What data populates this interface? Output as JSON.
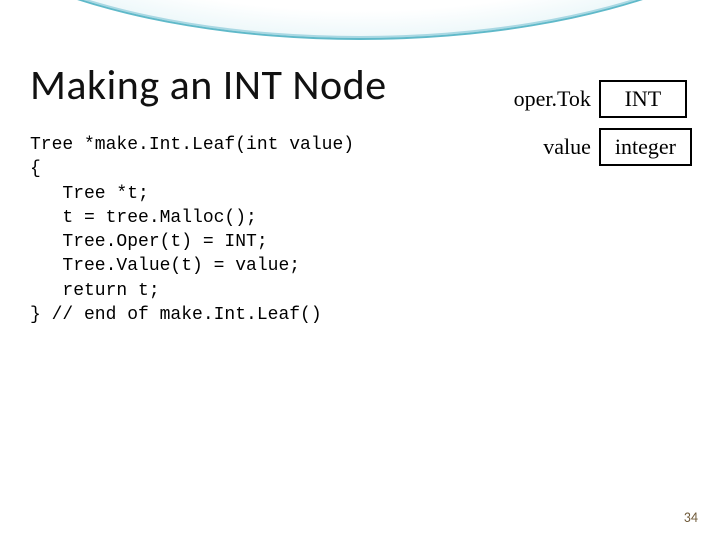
{
  "title": "Making an INT Node",
  "code": "Tree *make.Int.Leaf(int value)\n{\n   Tree *t;\n   t = tree.Malloc();\n   Tree.Oper(t) = INT;\n   Tree.Value(t) = value;\n   return t;\n} // end of make.Int.Leaf()",
  "diagram": {
    "row1": {
      "label": "oper.Tok",
      "box": "INT"
    },
    "row2": {
      "label": "value",
      "box": "integer"
    }
  },
  "slide_number": "34"
}
